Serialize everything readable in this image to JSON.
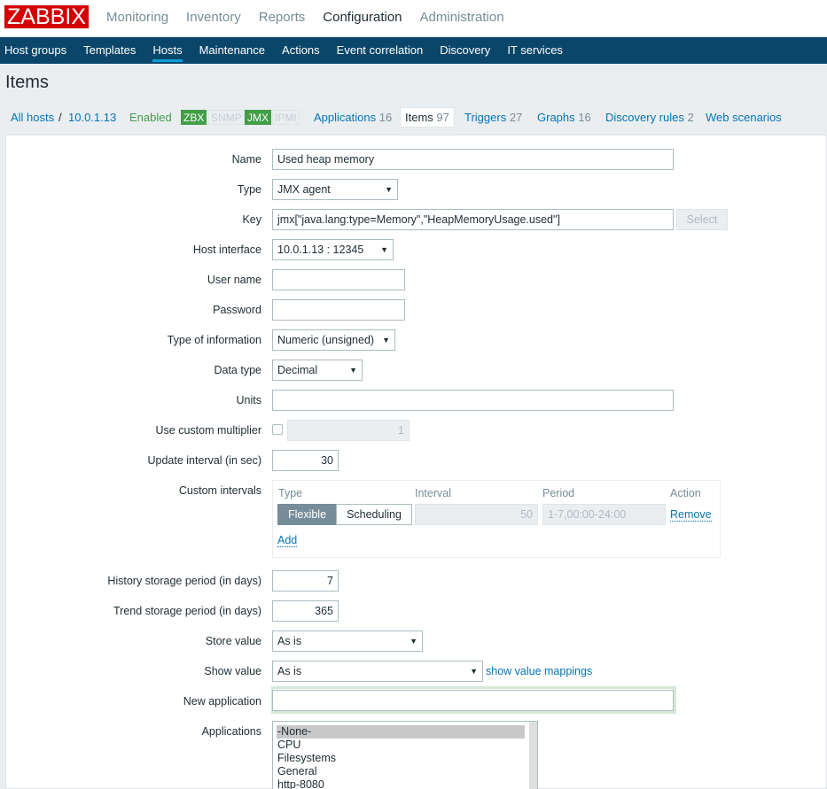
{
  "logo": "ZABBIX",
  "top_menu": [
    "Monitoring",
    "Inventory",
    "Reports",
    "Configuration",
    "Administration"
  ],
  "sub_menu": [
    "Host groups",
    "Templates",
    "Hosts",
    "Maintenance",
    "Actions",
    "Event correlation",
    "Discovery",
    "IT services"
  ],
  "page_title": "Items",
  "host_nav": {
    "all_hosts": "All hosts",
    "separator": "/",
    "host": "10.0.1.13",
    "status": "Enabled",
    "badges": [
      "ZBX",
      "SNMP",
      "JMX",
      "IPMI"
    ],
    "applications": "Applications",
    "applications_count": "16",
    "items": "Items",
    "items_count": "97",
    "triggers": "Triggers",
    "triggers_count": "27",
    "graphs": "Graphs",
    "graphs_count": "16",
    "discovery_rules": "Discovery rules",
    "discovery_rules_count": "2",
    "web_scenarios": "Web scenarios"
  },
  "form": {
    "name_label": "Name",
    "name_value": "Used heap memory",
    "type_label": "Type",
    "type_value": "JMX agent",
    "key_label": "Key",
    "key_value": "jmx[\"java.lang:type=Memory\",\"HeapMemoryUsage.used\"]",
    "select_button": "Select",
    "host_interface_label": "Host interface",
    "host_interface_value": "10.0.1.13 : 12345",
    "username_label": "User name",
    "username_value": "",
    "password_label": "Password",
    "password_value": "",
    "type_info_label": "Type of information",
    "type_info_value": "Numeric (unsigned)",
    "data_type_label": "Data type",
    "data_type_value": "Decimal",
    "units_label": "Units",
    "units_value": "",
    "custom_multiplier_label": "Use custom multiplier",
    "custom_multiplier_value": "1",
    "update_interval_label": "Update interval (in sec)",
    "update_interval_value": "30",
    "custom_intervals_label": "Custom intervals",
    "ci_headers": [
      "Type",
      "Interval",
      "Period",
      "Action"
    ],
    "ci_flexible": "Flexible",
    "ci_scheduling": "Scheduling",
    "ci_interval_value": "50",
    "ci_period_value": "1-7,00:00-24:00",
    "ci_remove": "Remove",
    "ci_add": "Add",
    "history_label": "History storage period (in days)",
    "history_value": "7",
    "trend_label": "Trend storage period (in days)",
    "trend_value": "365",
    "store_value_label": "Store value",
    "store_value_value": "As is",
    "show_value_label": "Show value",
    "show_value_value": "As is",
    "show_value_mappings": "show value mappings",
    "new_application_label": "New application",
    "new_application_value": "",
    "applications_label": "Applications",
    "applications_list": [
      "-None-",
      "CPU",
      "Filesystems",
      "General",
      "http-8080"
    ]
  },
  "colors": {
    "brand_red": "#d40000",
    "nav_blue": "#0a466a",
    "link_blue": "#0275b8",
    "enabled_green": "#429e47"
  }
}
